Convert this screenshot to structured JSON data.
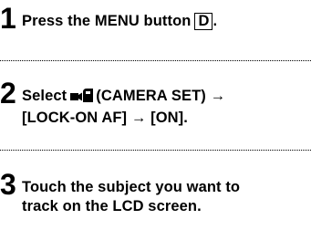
{
  "steps": [
    {
      "number": "1",
      "line1_prefix": "Press the MENU button",
      "boxed_letter": "D",
      "line1_suffix": "."
    },
    {
      "number": "2",
      "line1_prefix": "Select",
      "icon": "camera-set-icon",
      "line1_suffix": "(CAMERA SET) →",
      "line2": "[LOCK-ON AF] → [ON]."
    },
    {
      "number": "3",
      "line1": "Touch the subject you want to",
      "line2": "track on the LCD screen."
    }
  ]
}
